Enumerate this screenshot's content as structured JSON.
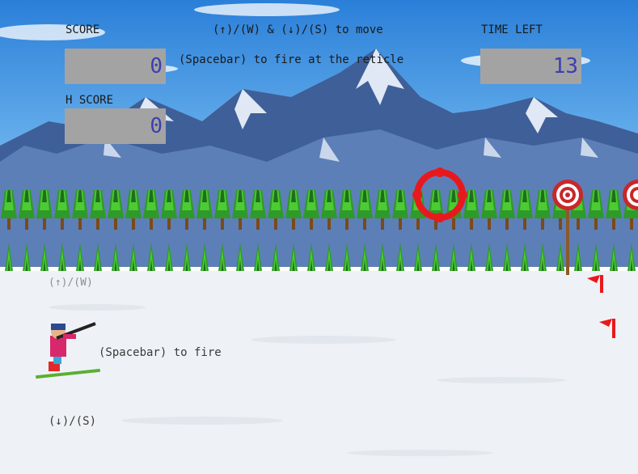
{
  "hud": {
    "score_label": "SCORE",
    "score_value": "0",
    "high_score_label": "H SCORE",
    "high_score_value": "0",
    "time_label": "TIME LEFT",
    "time_value": "13",
    "instructions_move": "(↑)/(W) & (↓)/(S) to move",
    "instructions_fire": "(Spacebar) to fire at the reticle"
  },
  "hints": {
    "up": "(↑)/(W)",
    "fire": "(Spacebar) to fire",
    "down": "(↓)/(S)"
  },
  "colors": {
    "sky_top": "#2a7fd8",
    "sky_bottom": "#bfe2ff",
    "snow": "#eef2f6",
    "reticle": "#e8191c",
    "target_red": "#c8282a",
    "hud_box": "#a3a3a3",
    "hud_digits": "#3b3fb0"
  },
  "icons": [
    "crosshair-icon",
    "target-icon",
    "flag-icon",
    "skier-icon"
  ]
}
